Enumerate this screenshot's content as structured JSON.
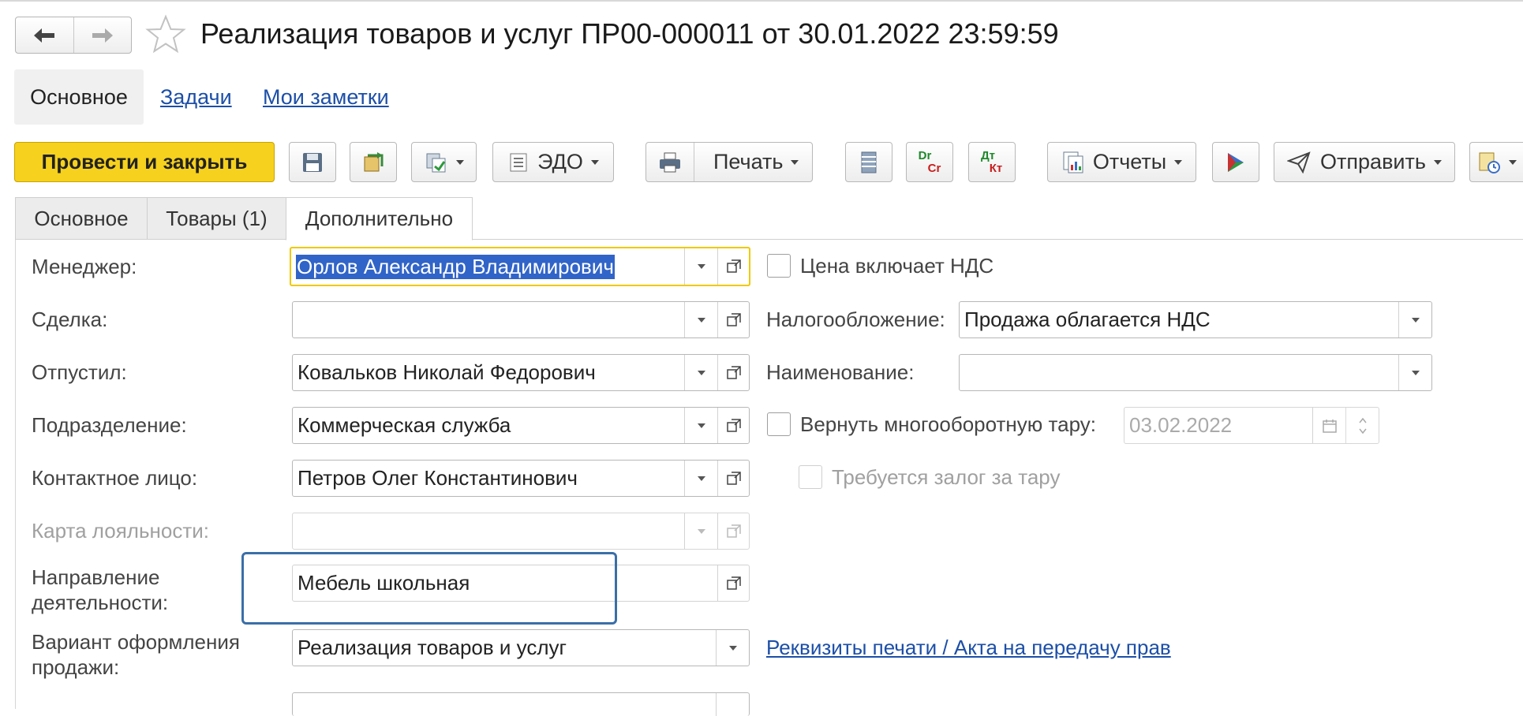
{
  "window": {
    "title": "Реализация товаров и услуг ПР00-000011 от 30.01.2022 23:59:59"
  },
  "sections": {
    "active": "Основное",
    "links": [
      "Задачи",
      "Мои заметки"
    ]
  },
  "toolbar": {
    "post_close": "Провести и закрыть",
    "edo": "ЭДО",
    "print": "Печать",
    "reports": "Отчеты",
    "send": "Отправить",
    "dt_kt_top": "Dr",
    "dt_kt_bottom": "Cr",
    "dt_kt2_top": "Дт",
    "dt_kt2_bottom": "Кт"
  },
  "tabs": [
    "Основное",
    "Товары (1)",
    "Дополнительно"
  ],
  "fields": {
    "manager": {
      "label": "Менеджер:",
      "value": "Орлов Александр Владимирович"
    },
    "deal": {
      "label": "Сделка:",
      "value": ""
    },
    "released": {
      "label": "Отпустил:",
      "value": "Ковальков Николай Федорович"
    },
    "department": {
      "label": "Подразделение:",
      "value": "Коммерческая служба"
    },
    "contact": {
      "label": "Контактное лицо:",
      "value": "Петров Олег Константинович"
    },
    "loyalty_card": {
      "label": "Карта лояльности:",
      "value": ""
    },
    "activity_line1": "Направление",
    "activity_line2": "деятельности:",
    "activity_value": "Мебель школьная",
    "variant_line1": "Вариант оформления",
    "variant_line2": "продажи:",
    "variant_value": "Реализация товаров и услуг",
    "price_vat": "Цена включает НДС",
    "taxation": {
      "label": "Налогообложение:",
      "value": "Продажа облагается НДС"
    },
    "naming": {
      "label": "Наименование:",
      "value": ""
    },
    "return_tare": {
      "label": "Вернуть многооборотную тару:",
      "date": "03.02.2022"
    },
    "deposit": "Требуется залог за тару",
    "print_details_link": "Реквизиты печати / Акта на передачу прав"
  },
  "colors": {
    "primary_button": "#f6d11d",
    "link": "#1c4fa8",
    "selection": "#3164c8",
    "highlight_box": "#3a6fa8"
  }
}
